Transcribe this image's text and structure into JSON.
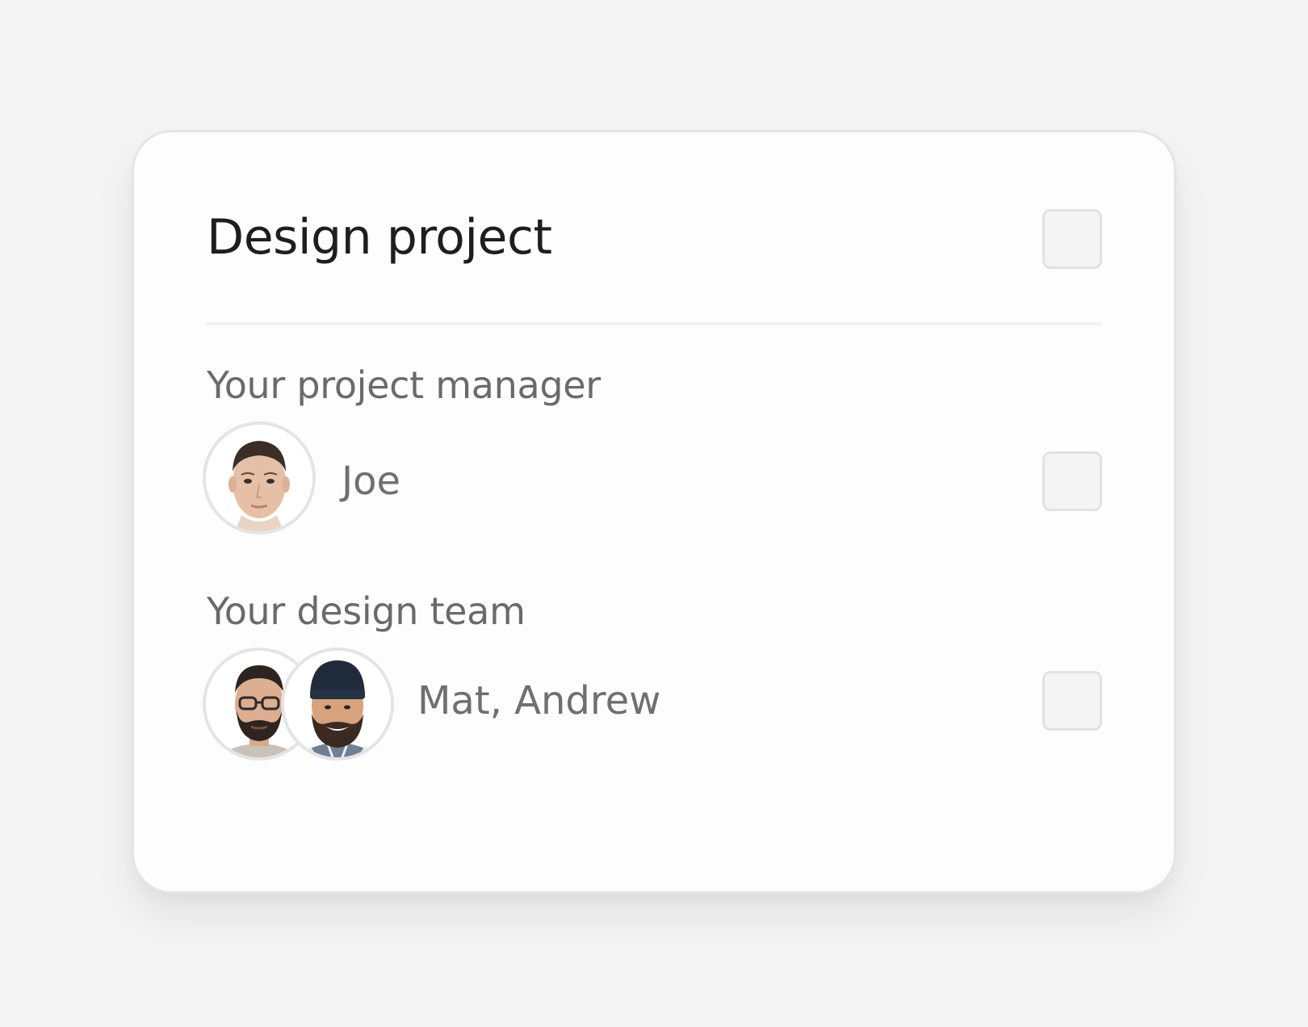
{
  "card": {
    "title": "Design project"
  },
  "sections": [
    {
      "label": "Your project manager",
      "names": "Joe",
      "avatars": [
        "joe-avatar"
      ]
    },
    {
      "label": "Your design team",
      "names": "Mat, Andrew",
      "avatars": [
        "mat-avatar",
        "andrew-avatar"
      ]
    }
  ],
  "colors": {
    "background": "#f4f4f4",
    "card": "#fdfdfd",
    "title_text": "#1e1e1e",
    "secondary_text": "#6a6a6a",
    "border": "#e4e4e4"
  }
}
